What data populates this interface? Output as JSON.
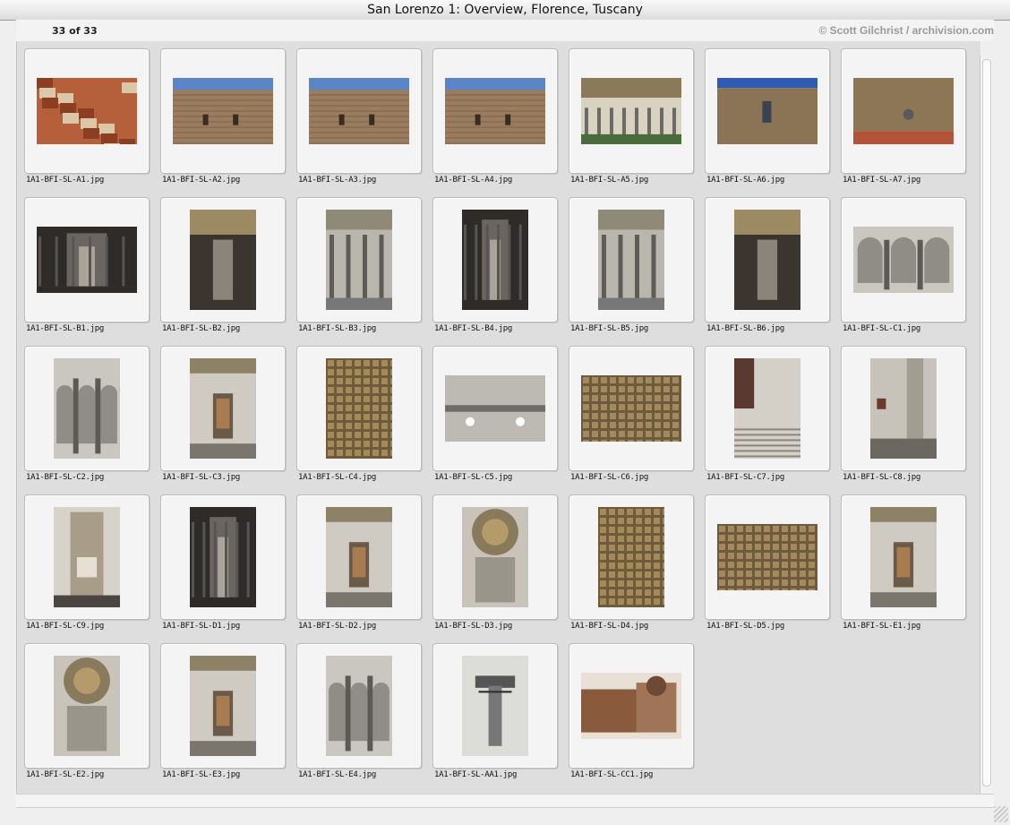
{
  "window": {
    "title": "San Lorenzo 1: Overview, Florence, Tuscany"
  },
  "header": {
    "count": "33 of 33",
    "credit": "© Scott Gilchrist / archivision.com"
  },
  "colors": {
    "window_bg": "#efefef",
    "panel_bg": "#dedede",
    "tile_bg": "#f4f4f4"
  },
  "thumbnails": [
    {
      "caption": "1A1-BFI-SL-A1.jpg",
      "orientation": "landscape",
      "scene": "city-rooftops"
    },
    {
      "caption": "1A1-BFI-SL-A2.jpg",
      "orientation": "landscape",
      "scene": "facade-sky"
    },
    {
      "caption": "1A1-BFI-SL-A3.jpg",
      "orientation": "landscape",
      "scene": "facade-sky"
    },
    {
      "caption": "1A1-BFI-SL-A4.jpg",
      "orientation": "landscape",
      "scene": "facade-sky"
    },
    {
      "caption": "1A1-BFI-SL-A5.jpg",
      "orientation": "landscape",
      "scene": "cloister"
    },
    {
      "caption": "1A1-BFI-SL-A6.jpg",
      "orientation": "landscape",
      "scene": "stone-wall"
    },
    {
      "caption": "1A1-BFI-SL-A7.jpg",
      "orientation": "landscape",
      "scene": "stone-wall-roof"
    },
    {
      "caption": "1A1-BFI-SL-B1.jpg",
      "orientation": "landscape",
      "scene": "nave-dark"
    },
    {
      "caption": "1A1-BFI-SL-B2.jpg",
      "orientation": "portrait",
      "scene": "nave-ceiling"
    },
    {
      "caption": "1A1-BFI-SL-B3.jpg",
      "orientation": "portrait",
      "scene": "arcade"
    },
    {
      "caption": "1A1-BFI-SL-B4.jpg",
      "orientation": "portrait",
      "scene": "nave-dark"
    },
    {
      "caption": "1A1-BFI-SL-B5.jpg",
      "orientation": "portrait",
      "scene": "arcade"
    },
    {
      "caption": "1A1-BFI-SL-B6.jpg",
      "orientation": "portrait",
      "scene": "nave-ceiling"
    },
    {
      "caption": "1A1-BFI-SL-C1.jpg",
      "orientation": "landscape",
      "scene": "arches-grey"
    },
    {
      "caption": "1A1-BFI-SL-C2.jpg",
      "orientation": "portrait",
      "scene": "arches-grey"
    },
    {
      "caption": "1A1-BFI-SL-C3.jpg",
      "orientation": "portrait",
      "scene": "chapel"
    },
    {
      "caption": "1A1-BFI-SL-C4.jpg",
      "orientation": "portrait",
      "scene": "ceiling-coffers"
    },
    {
      "caption": "1A1-BFI-SL-C5.jpg",
      "orientation": "landscape",
      "scene": "vault-grey"
    },
    {
      "caption": "1A1-BFI-SL-C6.jpg",
      "orientation": "landscape",
      "scene": "ceiling-coffers"
    },
    {
      "caption": "1A1-BFI-SL-C7.jpg",
      "orientation": "portrait",
      "scene": "steps"
    },
    {
      "caption": "1A1-BFI-SL-C8.jpg",
      "orientation": "portrait",
      "scene": "pier"
    },
    {
      "caption": "1A1-BFI-SL-C9.jpg",
      "orientation": "portrait",
      "scene": "tomb"
    },
    {
      "caption": "1A1-BFI-SL-D1.jpg",
      "orientation": "portrait",
      "scene": "nave-dark"
    },
    {
      "caption": "1A1-BFI-SL-D2.jpg",
      "orientation": "portrait",
      "scene": "chapel"
    },
    {
      "caption": "1A1-BFI-SL-D3.jpg",
      "orientation": "portrait",
      "scene": "dome"
    },
    {
      "caption": "1A1-BFI-SL-D4.jpg",
      "orientation": "portrait",
      "scene": "ceiling-coffers"
    },
    {
      "caption": "1A1-BFI-SL-D5.jpg",
      "orientation": "landscape",
      "scene": "ceiling-coffers"
    },
    {
      "caption": "1A1-BFI-SL-E1.jpg",
      "orientation": "portrait",
      "scene": "chapel"
    },
    {
      "caption": "1A1-BFI-SL-E2.jpg",
      "orientation": "portrait",
      "scene": "dome"
    },
    {
      "caption": "1A1-BFI-SL-E3.jpg",
      "orientation": "portrait",
      "scene": "chapel"
    },
    {
      "caption": "1A1-BFI-SL-E4.jpg",
      "orientation": "portrait",
      "scene": "arches-grey"
    },
    {
      "caption": "1A1-BFI-SL-AA1.jpg",
      "orientation": "portrait",
      "scene": "floor-plan"
    },
    {
      "caption": "1A1-BFI-SL-CC1.jpg",
      "orientation": "landscape",
      "scene": "sepia-photo"
    }
  ]
}
